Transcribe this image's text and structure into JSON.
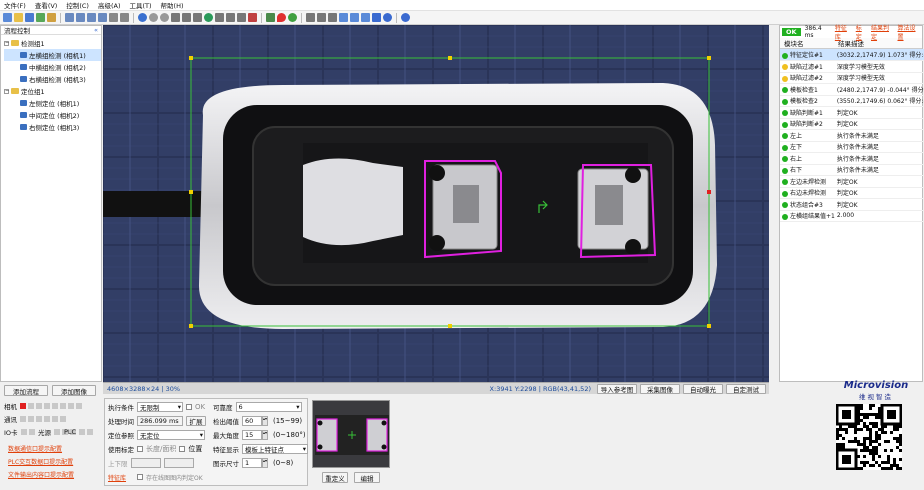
{
  "menu": [
    "文件(F)",
    "查看(V)",
    "控制(C)",
    "高级(A)",
    "工具(T)",
    "帮助(H)"
  ],
  "flow": {
    "title": "流程控制",
    "groups": [
      {
        "label": "检测组1",
        "items": [
          "左横组检测 (相机1)",
          "中横组检测 (相机2)",
          "右横组检测 (相机3)"
        ]
      },
      {
        "label": "定位组1",
        "items": [
          "左侧定位 (相机1)",
          "中间定位 (相机2)",
          "右侧定位 (相机3)"
        ]
      }
    ],
    "add_flow": "添加流程",
    "add_image": "添加图像"
  },
  "status": {
    "dims": "4608×3288×24 | 30%",
    "coords": "X:3941  Y:2298 | RGB(43,41,52)",
    "buttons": [
      "导入参考图",
      "采集图像",
      "自动曝光",
      "自定测试"
    ]
  },
  "results": {
    "ok_badge": "OK",
    "time": "386.4 ms",
    "links": [
      "特征库",
      "标定",
      "结果判定",
      "算法设置"
    ],
    "col_module": "模块名",
    "col_desc": "结果描述",
    "rows": [
      {
        "name": "特征定位#1",
        "desc": "(3032.2,1747.9) 1.073° 得分:82",
        "status": "green"
      },
      {
        "name": "缺陷过滤#1",
        "desc": "深度学习模型无效",
        "status": "yellow"
      },
      {
        "name": "缺陷过滤#2",
        "desc": "深度学习模型无效",
        "status": "yellow"
      },
      {
        "name": "模板检查1",
        "desc": "(2480.2,1747.9) -0.044° 得分:99",
        "status": "green"
      },
      {
        "name": "模板检查2",
        "desc": "(3550.2,1749.6) 0.062° 得分:86",
        "status": "green"
      },
      {
        "name": "缺陷判断#1",
        "desc": "判定OK",
        "status": "green"
      },
      {
        "name": "缺陷判断#2",
        "desc": "判定OK",
        "status": "green"
      },
      {
        "name": "左上",
        "desc": "执行条件未满足",
        "status": "green"
      },
      {
        "name": "左下",
        "desc": "执行条件未满足",
        "status": "green"
      },
      {
        "name": "右上",
        "desc": "执行条件未满足",
        "status": "green"
      },
      {
        "name": "右下",
        "desc": "执行条件未满足",
        "status": "green"
      },
      {
        "name": "左边未焊检测",
        "desc": "判定OK",
        "status": "green"
      },
      {
        "name": "右边未焊检测",
        "desc": "判定OK",
        "status": "green"
      },
      {
        "name": "状态组合#3",
        "desc": "判定OK",
        "status": "green"
      },
      {
        "name": "左横组结果值+1",
        "desc": "2.000",
        "status": "green"
      }
    ]
  },
  "io": {
    "labels": [
      "相机",
      "通讯",
      "IO卡",
      "光源",
      "PLC"
    ],
    "links": [
      "数据通信口提示配置",
      "PLC交互数据口提示配置",
      "文件输出内容口提示配置"
    ]
  },
  "params": {
    "exec_cond_label": "执行条件",
    "exec_cond_value": "无限制",
    "ok_label": "OK",
    "time_label": "处理时间",
    "time_value": "286.099 ms",
    "expand": "扩展",
    "locate_ref_label": "定位参照",
    "locate_ref_value": "无定位",
    "use_calib_label": "使用标定",
    "calib_opts": [
      "长度/面积",
      "位置"
    ],
    "ul_label": "上下限",
    "feature_lib": "特征库",
    "save_failed": "存在线图图内判定OK"
  },
  "match": {
    "sim_label": "可靠度",
    "sim_value": "6",
    "thresh_label": "检出阈值",
    "thresh_value": "60",
    "thresh_range": "(15~99)",
    "angle_label": "最大角度",
    "angle_value": "15",
    "angle_range": "(0~180°)",
    "feat_label": "特征显示",
    "feat_value": "模板上特征点",
    "size_label": "图示尺寸",
    "size_value": "1",
    "size_range": "(0~8)",
    "redefine": "重定义",
    "edit": "编辑"
  },
  "brand": {
    "name": "Microvision",
    "cn": "维视智造"
  },
  "colors": {
    "ok": "#20b020",
    "warn": "#f0c020",
    "link": "#e0400a",
    "overlay_magenta": "#e020e0",
    "overlay_green": "#38c038"
  }
}
